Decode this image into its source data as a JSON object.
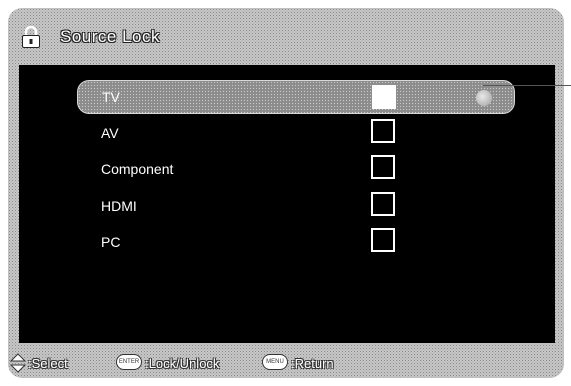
{
  "title": "Source Lock",
  "icons": {
    "title": "lock-icon",
    "navigate": "up-down-arrow-icon"
  },
  "items": [
    {
      "label": "TV",
      "locked": false,
      "selected": true
    },
    {
      "label": "AV",
      "locked": false,
      "selected": false
    },
    {
      "label": "Component",
      "locked": false,
      "selected": false
    },
    {
      "label": "HDMI",
      "locked": false,
      "selected": false
    },
    {
      "label": "PC",
      "locked": false,
      "selected": false
    }
  ],
  "hints": {
    "select_label": ":Select",
    "enter_key": "ENTER",
    "enter_label": ":Lock/Unlock",
    "menu_key": "MENU",
    "menu_label": ":Return"
  }
}
